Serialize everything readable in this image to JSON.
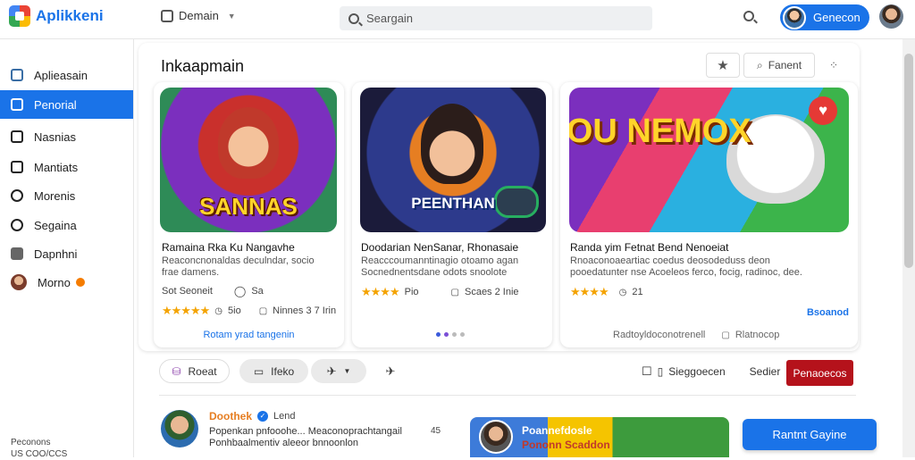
{
  "app": {
    "name": "Aplikkeni"
  },
  "header": {
    "nav_label": "Demain",
    "search_placeholder": "Seargain",
    "account_label": "Genecon"
  },
  "sidebar": {
    "items": [
      {
        "label": "Aplieasain",
        "icon": "apps-icon"
      },
      {
        "label": "Penorial",
        "icon": "home-icon",
        "active": true
      },
      {
        "label": "Nasnias",
        "icon": "inbox-icon"
      },
      {
        "label": "Mantiats",
        "icon": "grid-icon"
      },
      {
        "label": "Morenis",
        "icon": "person-icon"
      },
      {
        "label": "Segaina",
        "icon": "chat-icon"
      },
      {
        "label": "Dapnhni",
        "icon": "folder-icon"
      },
      {
        "label": "Morno",
        "icon": "avatar-icon"
      }
    ],
    "footer": [
      "Peconons",
      "US COO/CCS"
    ]
  },
  "panel": {
    "title": "Inkaapmain",
    "toolbar": {
      "fav_label": "",
      "search_label": "Fanent",
      "more_label": ""
    }
  },
  "cards": [
    {
      "thumb_text": "SANNAS",
      "title": "Ramaina Rka Ku Nangavhe",
      "desc": [
        "Reaconcnonaldas deculndar, socio",
        "frae damens."
      ],
      "author": "Sot Seoneit",
      "comments": "Sa",
      "rating": "★★★★★",
      "score": "5io",
      "size": "Ninnes 3 7 Irin",
      "link": "Rotam yrad tangenin"
    },
    {
      "thumb_text": "PEENTHAN",
      "title": "Doodarian NenSanar, Rhonasaie",
      "desc": [
        "Reacccoumanntinagio otoamo agan",
        "Socnednentsdane odots snoolote"
      ],
      "rating": "★★★★",
      "score": "Pio",
      "size": "Scaes 2 Inie"
    },
    {
      "thumb_text": "KOU NEMOX",
      "title": "Randa yim Fetnat Bend Nenoeiat",
      "desc": [
        "Rnoaconoaeartiac coedus deosodeduss deon",
        "pooedatunter nse Acoeleos ferco, focig, radinoc, dee."
      ],
      "rating": "★★★★",
      "score": "21",
      "tag": "Bsoanod",
      "footer_left": "Radtoyldoconotrenell",
      "footer_right": "Rlatnocop"
    }
  ],
  "actions": {
    "left": [
      "Roeat",
      "Ifeko",
      ""
    ],
    "right_label": "Sieggoecen",
    "secondary": "Sedier",
    "primary": "Penaoecos"
  },
  "feed": {
    "author": "Doothek",
    "tag": "Lend",
    "text": [
      "Popenkan pnfooohe... Meaconoprachtangail",
      "Ponhbaalmentiv aleeor bnnoonlon"
    ],
    "count": "45",
    "banner_title": "Poannefdosle",
    "banner_sub": "Pononn Scaddon",
    "cta": "Rantnt Gayine"
  },
  "colors": {
    "accent": "#1a73e8",
    "primary_action": "#b5121b"
  }
}
